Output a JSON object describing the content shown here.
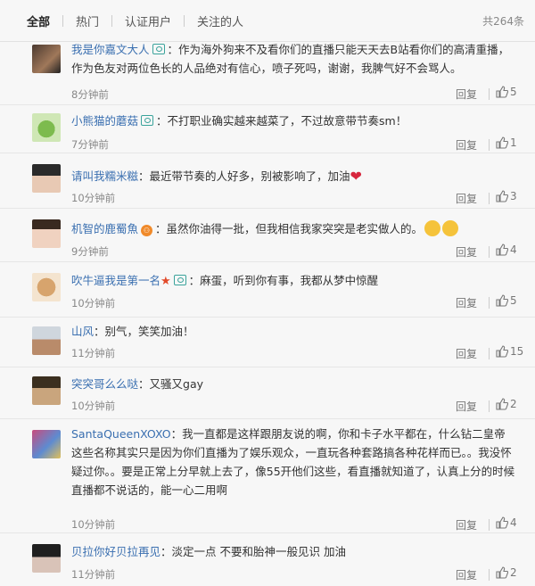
{
  "tabs": [
    {
      "label": "全部",
      "active": true
    },
    {
      "label": "热门",
      "active": false
    },
    {
      "label": "认证用户",
      "active": false
    },
    {
      "label": "关注的人",
      "active": false
    }
  ],
  "total_count": "共264条",
  "reply_label": "回复",
  "comments": [
    {
      "user": "我是你嘉文大人",
      "text": "：作为海外狗来不及看你们的直播只能天天去B站看你们的高清重播，作为色友对两位色长的人品绝对有信心，喷子死吗，谢谢，我脾气好不会骂人。",
      "time": "8分钟前",
      "likes": "5"
    },
    {
      "user": "小熊猫的蘑菇",
      "text": "：不打职业确实越来越菜了，不过故意带节奏sm！",
      "time": "7分钟前",
      "likes": "1"
    },
    {
      "user": "请叫我糯米糍",
      "text": "：最近带节奏的人好多，别被影响了，加油",
      "time": "10分钟前",
      "likes": "3"
    },
    {
      "user": "机智的鹿蜀魚",
      "text": "：虽然你油得一批，但我相信我家突突是老实做人的。",
      "time": "9分钟前",
      "likes": "4"
    },
    {
      "user": "吹牛逼我是第一名",
      "text": "：麻蛋，听到你有事，我都从梦中惊醒",
      "time": "10分钟前",
      "likes": "5"
    },
    {
      "user": "山风",
      "text": "：别气，笑笑加油！",
      "time": "11分钟前",
      "likes": "15"
    },
    {
      "user": "突突哥么么哒",
      "text": "：又骚又gay",
      "time": "10分钟前",
      "likes": "2"
    },
    {
      "user": "SantaQueenXOXO",
      "text": "：我一直都是这样跟朋友说的啊，你和卡子水平都在，什么钻二皇帝这些名称其实只是因为你们直播为了娱乐观众，一直玩各种套路搞各种花样而已。。我没怀疑过你。。要是正常上分早就上去了，像55开他们这些，看直播就知道了，认真上分的时候直播都不说话的，能一心二用啊",
      "time": "10分钟前",
      "likes": "4"
    },
    {
      "user": "贝拉你好贝拉再见",
      "text": "：淡定一点 不要和胎神一般见识 加油",
      "time": "11分钟前",
      "likes": "2"
    }
  ],
  "colors": {
    "username": "#3a6fb0",
    "badge": "#3aa39b",
    "heart": "#d7263d"
  }
}
